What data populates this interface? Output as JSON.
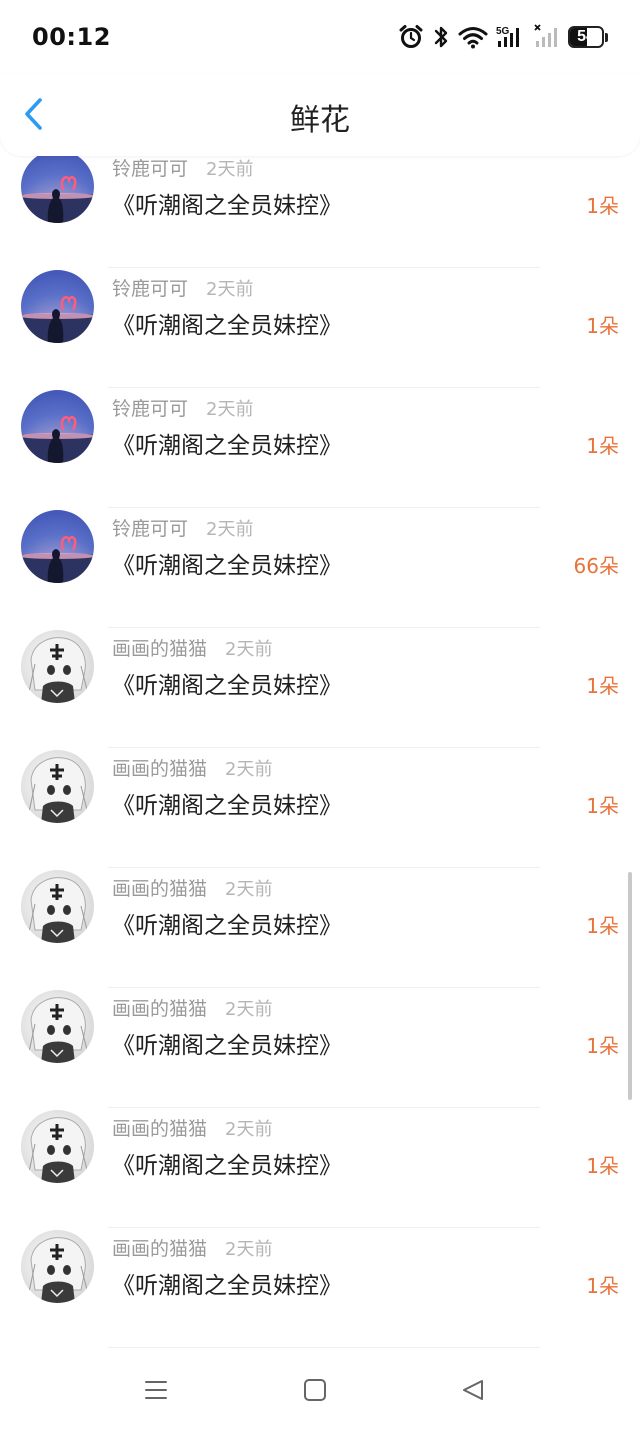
{
  "status_bar": {
    "time": "00:12",
    "network_label": "5G",
    "battery_level": 54,
    "battery_text": "54"
  },
  "header": {
    "title": "鲜花",
    "back_icon": "chevron-left-icon",
    "accent_color": "#2e9bf0"
  },
  "list": {
    "items": [
      {
        "name": "铃鹿可可",
        "time": "2天前",
        "title": "《听潮阁之全员妹控》",
        "count": "1朵",
        "avatar": "sunset"
      },
      {
        "name": "铃鹿可可",
        "time": "2天前",
        "title": "《听潮阁之全员妹控》",
        "count": "1朵",
        "avatar": "sunset"
      },
      {
        "name": "铃鹿可可",
        "time": "2天前",
        "title": "《听潮阁之全员妹控》",
        "count": "1朵",
        "avatar": "sunset"
      },
      {
        "name": "铃鹿可可",
        "time": "2天前",
        "title": "《听潮阁之全员妹控》",
        "count": "66朵",
        "avatar": "sunset"
      },
      {
        "name": "画画的猫猫",
        "time": "2天前",
        "title": "《听潮阁之全员妹控》",
        "count": "1朵",
        "avatar": "anime"
      },
      {
        "name": "画画的猫猫",
        "time": "2天前",
        "title": "《听潮阁之全员妹控》",
        "count": "1朵",
        "avatar": "anime"
      },
      {
        "name": "画画的猫猫",
        "time": "2天前",
        "title": "《听潮阁之全员妹控》",
        "count": "1朵",
        "avatar": "anime"
      },
      {
        "name": "画画的猫猫",
        "time": "2天前",
        "title": "《听潮阁之全员妹控》",
        "count": "1朵",
        "avatar": "anime"
      },
      {
        "name": "画画的猫猫",
        "time": "2天前",
        "title": "《听潮阁之全员妹控》",
        "count": "1朵",
        "avatar": "anime"
      },
      {
        "name": "画画的猫猫",
        "time": "2天前",
        "title": "《听潮阁之全员妹控》",
        "count": "1朵",
        "avatar": "anime"
      }
    ],
    "count_color": "#e8733a"
  },
  "nav_bar": {
    "menu_icon": "menu-icon",
    "home_icon": "home-square-icon",
    "back_icon": "back-triangle-icon"
  }
}
